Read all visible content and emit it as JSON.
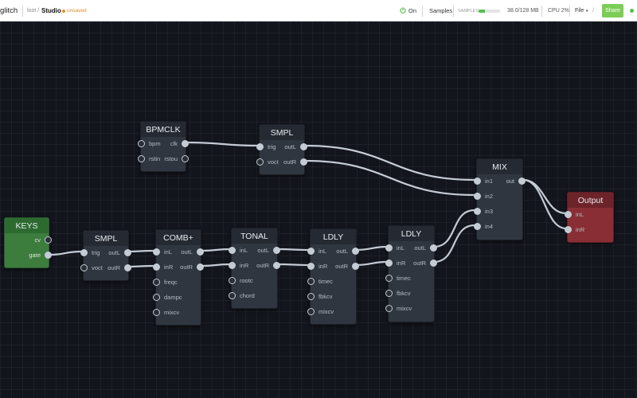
{
  "header": {
    "app_name": "glitch",
    "breadcrumb_root": "loot /",
    "project_name": "Studio",
    "unsaved_label": "unsaved",
    "power_label": "On",
    "samples_label": "Samples",
    "samples_tag": "SAMPLES",
    "memory_used_fraction": 0.3,
    "memory_text": "38.0/128 MB",
    "cpu_text": "CPU 2%",
    "file_menu": "File",
    "file_caret": "▾",
    "file_sep": "/",
    "share_label": "Share",
    "colors": {
      "accent": "#7ccd55",
      "status_ok": "#52c04a",
      "unsaved": "#d48a2a"
    }
  },
  "nodes": {
    "bpmclk": {
      "title": "BPMCLK",
      "inputs": [
        "bpm",
        "rstin"
      ],
      "outputs": [
        "clk",
        "rstou"
      ]
    },
    "smpl_top": {
      "title": "SMPL",
      "inputs": [
        "trig",
        "voct"
      ],
      "outputs": [
        "outL",
        "outR"
      ]
    },
    "mix": {
      "title": "MIX",
      "inputs": [
        "in1",
        "in2",
        "in3",
        "in4"
      ],
      "outputs": [
        "out"
      ]
    },
    "output": {
      "title": "Output",
      "inputs": [
        "inL",
        "inR"
      ]
    },
    "keys": {
      "title": "KEYS",
      "outputs": [
        "cv",
        "gate"
      ]
    },
    "smpl": {
      "title": "SMPL",
      "inputs": [
        "trig",
        "voct"
      ],
      "outputs": [
        "outL",
        "outR"
      ]
    },
    "comb": {
      "title": "COMB+",
      "inputs": [
        "inL",
        "inR",
        "freqc",
        "dampc",
        "mixcv"
      ],
      "outputs": [
        "outL",
        "outR"
      ]
    },
    "tonal": {
      "title": "TONAL",
      "inputs": [
        "inL",
        "inR",
        "rootc",
        "chord"
      ],
      "outputs": [
        "outL",
        "outR"
      ]
    },
    "ldly1": {
      "title": "LDLY",
      "inputs": [
        "inL",
        "inR",
        "timec",
        "fbkcv",
        "mixcv"
      ],
      "outputs": [
        "outL",
        "outR"
      ]
    },
    "ldly2": {
      "title": "LDLY",
      "inputs": [
        "inL",
        "inR",
        "timec",
        "fbkcv",
        "mixcv"
      ],
      "outputs": [
        "outL",
        "outR"
      ]
    }
  },
  "colors": {
    "canvas": "#12151c",
    "node_body": "#30363f",
    "keys_node": "#3c7d3e",
    "output_node": "#8a2e35",
    "wire": "#c4cbd4"
  }
}
